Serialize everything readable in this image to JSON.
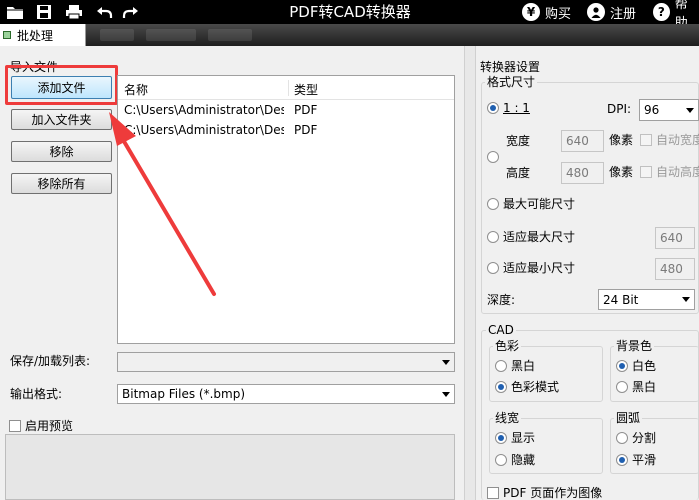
{
  "app": {
    "title": "PDF转CAD转换器"
  },
  "topbar": {
    "buy_label": "购买",
    "register_label": "注册",
    "help_label": "帮助"
  },
  "tabs": {
    "batch_label": "批处理"
  },
  "left": {
    "import_label": "导入文件",
    "buttons": {
      "add_file": "添加文件",
      "add_folder": "加入文件夹",
      "remove": "移除",
      "remove_all": "移除所有"
    },
    "file_list": {
      "columns": [
        "名称",
        "类型"
      ],
      "rows": [
        {
          "name": "C:\\Users\\Administrator\\Desktop\\",
          "type": "PDF"
        },
        {
          "name": "C:\\Users\\Administrator\\Desktop\\",
          "type": "PDF"
        }
      ]
    },
    "save_load_label": "保存/加载列表:",
    "save_load_value": "",
    "output_format_label": "输出格式:",
    "output_format_value": "Bitmap Files (*.bmp)",
    "enable_preview_label": "启用预览"
  },
  "right": {
    "settings_label": "转换器设置",
    "format_size": {
      "title": "格式尺寸",
      "ratio_label": "1 : 1",
      "dpi_label": "DPI:",
      "dpi_value": "96",
      "width_label": "宽度",
      "width_value": "640",
      "height_label": "高度",
      "height_value": "480",
      "pixel_label": "像素",
      "auto_width_label": "自动宽度",
      "auto_height_label": "自动高度",
      "max_possible_label": "最大可能尺寸",
      "fit_max_label": "适应最大尺寸",
      "fit_max_value": "640",
      "fit_min_label": "适应最小尺寸",
      "fit_min_value": "480",
      "depth_label": "深度:",
      "depth_value": "24 Bit"
    },
    "cad": {
      "title": "CAD",
      "color": {
        "title": "色彩",
        "options": [
          "黑白",
          "色彩模式"
        ],
        "selected": 1
      },
      "background": {
        "title": "背景色",
        "options": [
          "白色",
          "黑白"
        ],
        "selected": 0
      },
      "linewidth": {
        "title": "线宽",
        "options": [
          "显示",
          "隐藏"
        ],
        "selected": 0
      },
      "arc": {
        "title": "圆弧",
        "options": [
          "分割",
          "平滑"
        ],
        "selected": 1
      }
    },
    "pdf_as_image_label": "PDF 页面作为图像"
  },
  "colors": {
    "highlight_red": "#ee3b3b",
    "radio_blue": "#1f5fb0"
  }
}
